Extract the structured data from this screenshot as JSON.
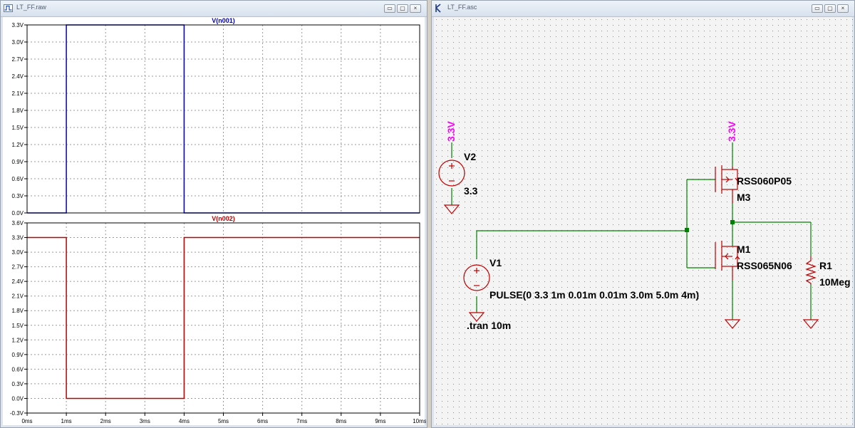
{
  "waveform_window": {
    "title": "LT_FF.raw",
    "buttons": {
      "minimize": "▭",
      "restore": "▢",
      "close": "×"
    },
    "plot_area_bg": "#ffffff",
    "grid_color": "#9a9a9a"
  },
  "schematic_window": {
    "title": "LT_FF.asc",
    "buttons": {
      "minimize": "▭",
      "restore": "▢",
      "close": "×"
    },
    "wire_color": "#008000",
    "component_color": "#c00000",
    "flag_color": "#ff00ff",
    "components": {
      "v2": {
        "ref": "V2",
        "value": "3.3",
        "flag": "3.3V"
      },
      "v1": {
        "ref": "V1",
        "value": "PULSE(0 3.3 1m 0.01m 0.01m 3.0m 5.0m 4m)"
      },
      "m3": {
        "ref": "M3",
        "model": "RSS060P05",
        "flag": "3.3V"
      },
      "m1": {
        "ref": "M1",
        "model": "RSS065N06"
      },
      "r1": {
        "ref": "R1",
        "value": "10Meg"
      },
      "directive": ".tran 10m"
    }
  },
  "chart_data": [
    {
      "type": "line",
      "title": "V(n001)",
      "series": [
        {
          "name": "V(n001)",
          "color": "#0000c0",
          "x": [
            0,
            1.0,
            1.0,
            4.0,
            4.0,
            10
          ],
          "values": [
            0,
            0,
            3.3,
            3.3,
            0,
            0
          ]
        }
      ],
      "xlabel": "",
      "ylabel": "",
      "xlim": [
        0,
        10
      ],
      "ylim": [
        0,
        3.3
      ],
      "yticks": [
        "0.0V",
        "0.3V",
        "0.6V",
        "0.9V",
        "1.2V",
        "1.5V",
        "1.8V",
        "2.1V",
        "2.4V",
        "2.7V",
        "3.0V",
        "3.3V"
      ],
      "xticks": [],
      "grid": true
    },
    {
      "type": "line",
      "title": "V(n002)",
      "series": [
        {
          "name": "V(n002)",
          "color": "#c00000",
          "x": [
            0,
            1.0,
            1.0,
            4.0,
            4.0,
            10
          ],
          "values": [
            3.3,
            3.3,
            0,
            0,
            3.3,
            3.3
          ]
        }
      ],
      "xlabel": "",
      "ylabel": "",
      "xlim": [
        0,
        10
      ],
      "ylim": [
        -0.3,
        3.6
      ],
      "yticks": [
        "-0.3V",
        "0.0V",
        "0.3V",
        "0.6V",
        "0.9V",
        "1.2V",
        "1.5V",
        "1.8V",
        "2.1V",
        "2.4V",
        "2.7V",
        "3.0V",
        "3.3V",
        "3.6V"
      ],
      "xticks": [
        "0ms",
        "1ms",
        "2ms",
        "3ms",
        "4ms",
        "5ms",
        "6ms",
        "7ms",
        "8ms",
        "9ms",
        "10ms"
      ],
      "grid": true
    }
  ]
}
